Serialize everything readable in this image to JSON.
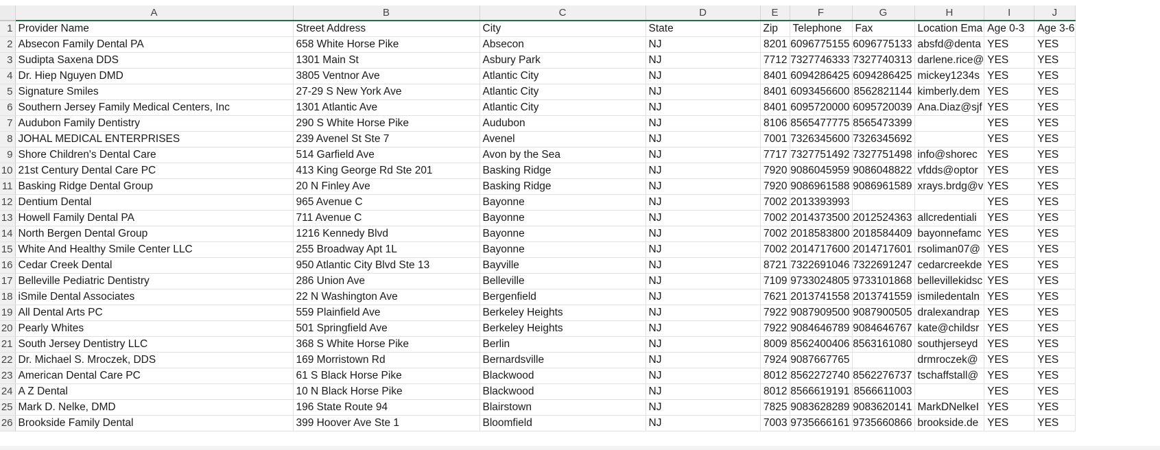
{
  "columns": [
    "A",
    "B",
    "C",
    "D",
    "E",
    "F",
    "G",
    "H",
    "I",
    "J"
  ],
  "headers": [
    "Provider Name",
    "Street Address",
    "City",
    "State",
    "Zip",
    "Telephone",
    "Fax",
    "Location Ema",
    "Age 0-3",
    "Age 3-6"
  ],
  "rows": [
    [
      "Absecon Family Dental PA",
      "658 White Horse Pike",
      "Absecon",
      "NJ",
      "8201",
      "6096775155",
      "6096775133",
      "absfd@denta",
      "YES",
      "YES"
    ],
    [
      "Sudipta Saxena DDS",
      "1301 Main St",
      "Asbury Park",
      "NJ",
      "7712",
      "7327746333",
      "7327740313",
      "darlene.rice@",
      "YES",
      "YES"
    ],
    [
      "Dr. Hiep Nguyen DMD",
      "3805 Ventnor Ave",
      "Atlantic City",
      "NJ",
      "8401",
      "6094286425",
      "6094286425",
      "mickey1234s",
      "YES",
      "YES"
    ],
    [
      "Signature Smiles",
      "27-29 S New York Ave",
      "Atlantic City",
      "NJ",
      "8401",
      "6093456600",
      "8562821144",
      "kimberly.dem",
      "YES",
      "YES"
    ],
    [
      "Southern Jersey Family Medical Centers, Inc",
      "1301 Atlantic Ave",
      "Atlantic City",
      "NJ",
      "8401",
      "6095720000",
      "6095720039",
      "Ana.Diaz@sjf",
      "YES",
      "YES"
    ],
    [
      "Audubon Family Dentistry",
      "290 S White Horse Pike",
      "Audubon",
      "NJ",
      "8106",
      "8565477775",
      "8565473399",
      "",
      "YES",
      "YES"
    ],
    [
      "JOHAL MEDICAL ENTERPRISES",
      "239 Avenel St Ste 7",
      "Avenel",
      "NJ",
      "7001",
      "7326345600",
      "7326345692",
      "",
      "YES",
      "YES"
    ],
    [
      "Shore Children's Dental Care",
      "514 Garfield Ave",
      "Avon by the Sea",
      "NJ",
      "7717",
      "7327751492",
      "7327751498",
      "info@shorec",
      "YES",
      "YES"
    ],
    [
      "21st Century Dental Care PC",
      "413 King George Rd Ste 201",
      "Basking Ridge",
      "NJ",
      "7920",
      "9086045959",
      "9086048822",
      "vfdds@optor",
      "YES",
      "YES"
    ],
    [
      "Basking Ridge Dental Group",
      "20 N Finley Ave",
      "Basking Ridge",
      "NJ",
      "7920",
      "9086961588",
      "9086961589",
      "xrays.brdg@v",
      "YES",
      "YES"
    ],
    [
      "Dentium Dental",
      "965 Avenue C",
      "Bayonne",
      "NJ",
      "7002",
      "2013393993",
      "",
      "",
      "YES",
      "YES"
    ],
    [
      "Howell Family Dental PA",
      "711 Avenue C",
      "Bayonne",
      "NJ",
      "7002",
      "2014373500",
      "2012524363",
      "allcredentiali",
      "YES",
      "YES"
    ],
    [
      "North Bergen Dental Group",
      "1216 Kennedy Blvd",
      "Bayonne",
      "NJ",
      "7002",
      "2018583800",
      "2018584409",
      "bayonnefamc",
      "YES",
      "YES"
    ],
    [
      "White And Healthy Smile Center LLC",
      "255 Broadway Apt 1L",
      "Bayonne",
      "NJ",
      "7002",
      "2014717600",
      "2014717601",
      "rsoliman07@",
      "YES",
      "YES"
    ],
    [
      "Cedar Creek Dental",
      "950 Atlantic City Blvd Ste 13",
      "Bayville",
      "NJ",
      "8721",
      "7322691046",
      "7322691247",
      "cedarcreekde",
      "YES",
      "YES"
    ],
    [
      "Belleville Pediatric Dentistry",
      "286 Union Ave",
      "Belleville",
      "NJ",
      "7109",
      "9733024805",
      "9733101868",
      "bellevillekidsc",
      "YES",
      "YES"
    ],
    [
      "iSmile Dental Associates",
      "22 N Washington Ave",
      "Bergenfield",
      "NJ",
      "7621",
      "2013741558",
      "2013741559",
      "ismiledentaln",
      "YES",
      "YES"
    ],
    [
      "All Dental Arts PC",
      "559 Plainfield Ave",
      "Berkeley Heights",
      "NJ",
      "7922",
      "9087909500",
      "9087900505",
      "dralexandrap",
      "YES",
      "YES"
    ],
    [
      "Pearly Whites",
      "501 Springfield Ave",
      "Berkeley Heights",
      "NJ",
      "7922",
      "9084646789",
      "9084646767",
      "kate@childsr",
      "YES",
      "YES"
    ],
    [
      "South Jersey Dentistry LLC",
      "368 S White Horse Pike",
      "Berlin",
      "NJ",
      "8009",
      "8562400406",
      "8563161080",
      "southjerseyd",
      "YES",
      "YES"
    ],
    [
      "Dr. Michael S. Mroczek, DDS",
      "169 Morristown Rd",
      "Bernardsville",
      "NJ",
      "7924",
      "9087667765",
      "",
      "drmroczek@",
      "YES",
      "YES"
    ],
    [
      "American Dental Care PC",
      "61 S Black Horse Pike",
      "Blackwood",
      "NJ",
      "8012",
      "8562272740",
      "8562276737",
      "tschaffstall@",
      "YES",
      "YES"
    ],
    [
      "A Z Dental",
      "10 N Black Horse Pike",
      "Blackwood",
      "NJ",
      "8012",
      "8566619191",
      "8566611003",
      "",
      "YES",
      "YES"
    ],
    [
      "Mark D. Nelke, DMD",
      "196 State Route 94",
      "Blairstown",
      "NJ",
      "7825",
      "9083628289",
      "9083620141",
      "MarkDNelkeI",
      "YES",
      "YES"
    ],
    [
      "Brookside Family Dental",
      "399 Hoover Ave Ste 1",
      "Bloomfield",
      "NJ",
      "7003",
      "9735666161",
      "9735660866",
      "brookside.de",
      "YES",
      "YES"
    ]
  ]
}
